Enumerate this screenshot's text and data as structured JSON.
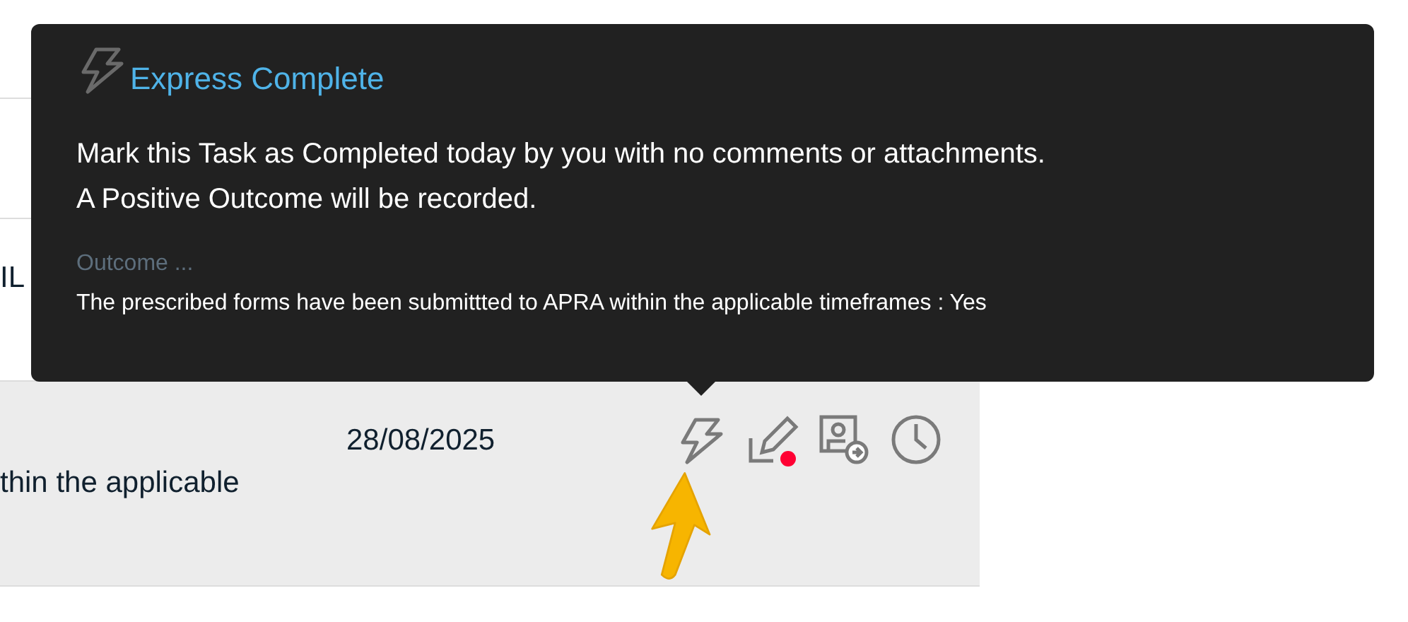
{
  "table": {
    "rows": [
      {
        "column_1": "IL",
        "selected": false
      },
      {
        "column_1": "thin the applicable",
        "date": "28/08/2025",
        "edit_flagged": true,
        "selected": true
      }
    ]
  },
  "tooltip": {
    "title": "Express Complete",
    "lines": [
      "Mark this Task as Completed today by you with no comments or attachments.",
      "A Positive Outcome will be recorded."
    ],
    "outcome_label": "Outcome ...",
    "outcome_text": "The prescribed forms have been submittted to APRA within the applicable timeframes : Yes"
  }
}
